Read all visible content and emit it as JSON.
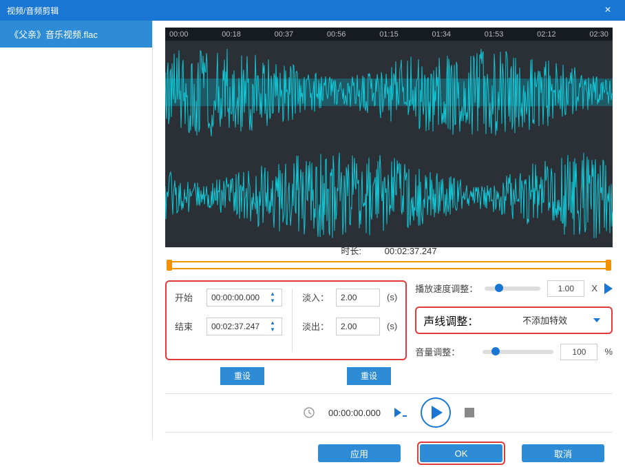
{
  "title": "视频/音频剪辑",
  "sidebar": {
    "file": "《父亲》音乐视频.flac"
  },
  "timeline": [
    "00:00",
    "00:18",
    "00:37",
    "00:56",
    "01:15",
    "01:34",
    "01:53",
    "02:12",
    "02:30"
  ],
  "duration": {
    "label": "时长:",
    "value": "00:02:37.247"
  },
  "trim": {
    "start_label": "开始",
    "start_value": "00:00:00.000",
    "end_label": "结束",
    "end_value": "00:02:37.247",
    "reset": "重设"
  },
  "fade": {
    "in_label": "淡入：",
    "in_value": "2.00",
    "in_unit": "(s)",
    "out_label": "淡出：",
    "out_value": "2.00",
    "out_unit": "(s)",
    "reset": "重设"
  },
  "speed": {
    "label": "播放速度调整：",
    "value": "1.00",
    "unit": "X",
    "thumb_pct": 18
  },
  "voice": {
    "label": "声线调整：",
    "value": "不添加特效"
  },
  "volume": {
    "label": "音量调整：",
    "value": "100",
    "unit": "%",
    "thumb_pct": 12
  },
  "playbar": {
    "time": "00:00:00.000"
  },
  "footer": {
    "apply": "应用",
    "ok": "OK",
    "cancel": "取消"
  }
}
